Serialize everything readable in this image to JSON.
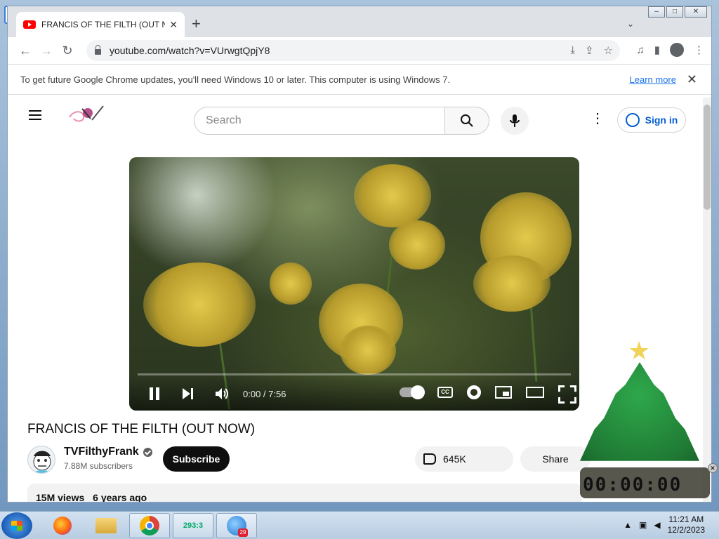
{
  "browser": {
    "tab_title": "FRANCIS OF THE FILTH (OUT NOW)",
    "url": "youtube.com/watch?v=VUrwgtQpjY8",
    "infobar_text": "To get future Google Chrome updates, you'll need Windows 10 or later. This computer is using Windows 7.",
    "learn_more": "Learn more"
  },
  "youtube": {
    "search_placeholder": "Search",
    "signin_label": "Sign in",
    "player": {
      "current_time": "0:00",
      "duration": "7:56",
      "time_display": "0:00 / 7:56"
    },
    "video_title": "FRANCIS OF THE FILTH (OUT NOW)",
    "channel_name": "TVFilthyFrank",
    "subscribers": "7.88M subscribers",
    "subscribe_label": "Subscribe",
    "likes": "645K",
    "share_label": "Share",
    "views": "15M views",
    "published": "6 years ago"
  },
  "gadget": {
    "digits": "00:00:00"
  },
  "taskbar": {
    "tree_badge": "293:3",
    "globe_badge": "29",
    "time": "11:21 AM",
    "date": "12/2/2023"
  },
  "colors": {
    "youtube_red": "#ff0000",
    "link_blue": "#1a73e8",
    "signin_blue": "#065fd4"
  }
}
